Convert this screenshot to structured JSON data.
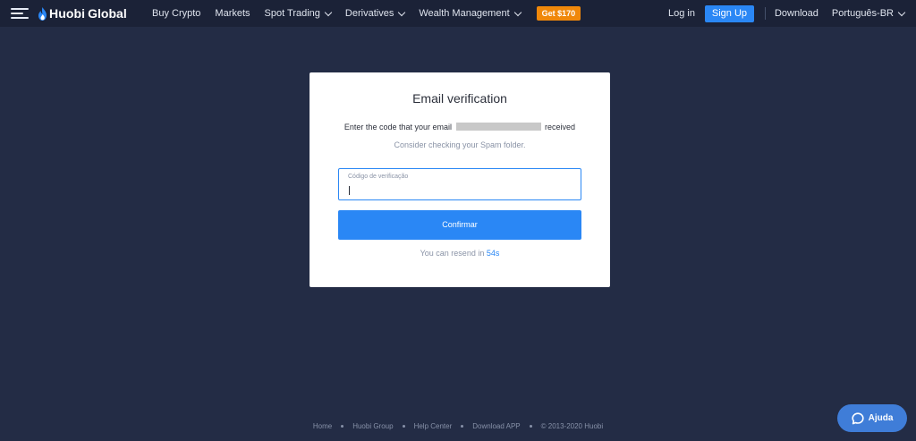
{
  "header": {
    "logo_huobi": "Huobi",
    "logo_global": "Global",
    "nav": [
      {
        "label": "Buy Crypto",
        "dropdown": false
      },
      {
        "label": "Markets",
        "dropdown": false
      },
      {
        "label": "Spot Trading",
        "dropdown": true
      },
      {
        "label": "Derivatives",
        "dropdown": true
      },
      {
        "label": "Wealth Management",
        "dropdown": true
      }
    ],
    "promo_label": "Get $170",
    "login_label": "Log in",
    "signup_label": "Sign Up",
    "download_label": "Download",
    "language_label": "Português-BR"
  },
  "verification": {
    "title": "Email verification",
    "instruction_prefix": "Enter the code that your email",
    "instruction_suffix": "received",
    "spam_hint": "Consider checking your Spam folder.",
    "code_label": "Código de verificação",
    "code_value": "",
    "confirm_label": "Confirmar",
    "resend_prefix": "You can resend in",
    "countdown": "54s"
  },
  "footer": {
    "links": [
      "Home",
      "Huobi Group",
      "Help Center",
      "Download APP"
    ],
    "copyright": "© 2013-2020 Huobi"
  },
  "help": {
    "label": "Ajuda"
  },
  "colors": {
    "background": "#232c45",
    "topbar": "#1b2237",
    "accent": "#2a87f5",
    "promo": "#f0880a",
    "help_button": "#3f7dd8"
  }
}
